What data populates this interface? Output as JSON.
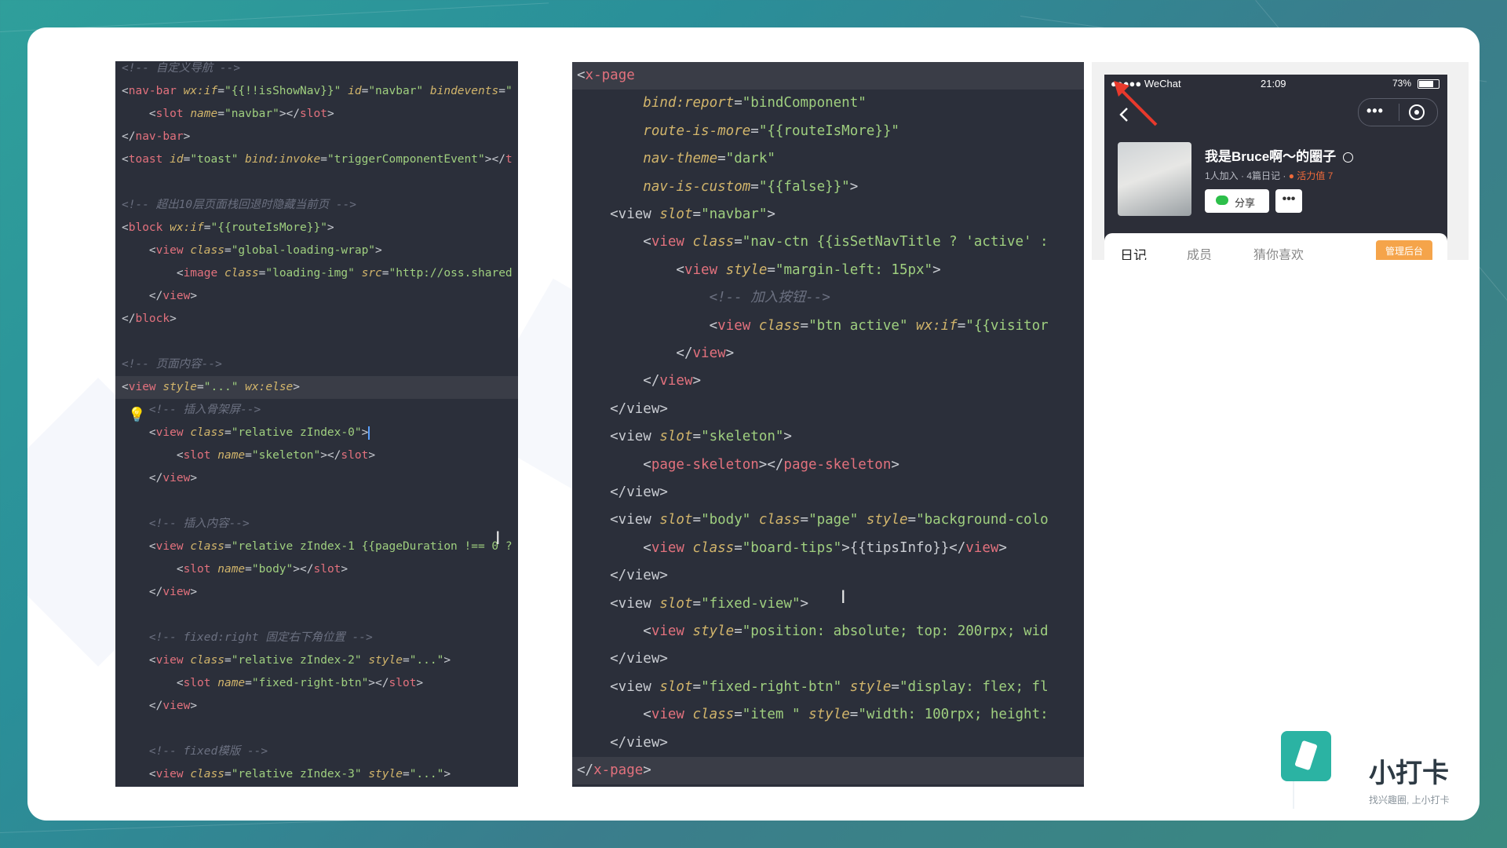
{
  "left_panel": {
    "lines": [
      [
        [
          "c",
          "<!-- 自定义导航 -->"
        ]
      ],
      [
        [
          "p",
          "<"
        ],
        [
          "t",
          "nav-bar"
        ],
        [
          "p",
          " "
        ],
        [
          "a",
          "wx:if"
        ],
        [
          "p",
          "="
        ],
        [
          "v",
          "\"{{!!isShowNav}}\""
        ],
        [
          "p",
          " "
        ],
        [
          "a",
          "id"
        ],
        [
          "p",
          "="
        ],
        [
          "v",
          "\"navbar\""
        ],
        [
          "p",
          " "
        ],
        [
          "a",
          "bindevents"
        ],
        [
          "p",
          "="
        ],
        [
          "v",
          "\""
        ]
      ],
      [
        [
          "p",
          "    <"
        ],
        [
          "t",
          "slot"
        ],
        [
          "p",
          " "
        ],
        [
          "a",
          "name"
        ],
        [
          "p",
          "="
        ],
        [
          "v",
          "\"navbar\""
        ],
        [
          "p",
          "></"
        ],
        [
          "t",
          "slot"
        ],
        [
          "p",
          ">"
        ]
      ],
      [
        [
          "p",
          "</"
        ],
        [
          "t",
          "nav-bar"
        ],
        [
          "p",
          ">"
        ]
      ],
      [
        [
          "p",
          "<"
        ],
        [
          "t",
          "toast"
        ],
        [
          "p",
          " "
        ],
        [
          "a",
          "id"
        ],
        [
          "p",
          "="
        ],
        [
          "v",
          "\"toast\""
        ],
        [
          "p",
          " "
        ],
        [
          "a",
          "bind:invoke"
        ],
        [
          "p",
          "="
        ],
        [
          "v",
          "\"triggerComponentEvent\""
        ],
        [
          "p",
          "></"
        ],
        [
          "t",
          "t"
        ]
      ],
      [
        [
          "p",
          ""
        ]
      ],
      [
        [
          "c",
          "<!-- 超出10层页面栈回退时隐藏当前页 -->"
        ]
      ],
      [
        [
          "p",
          "<"
        ],
        [
          "t",
          "block"
        ],
        [
          "p",
          " "
        ],
        [
          "a",
          "wx:if"
        ],
        [
          "p",
          "="
        ],
        [
          "v",
          "\"{{routeIsMore}}\""
        ],
        [
          "p",
          ">"
        ]
      ],
      [
        [
          "p",
          "    <"
        ],
        [
          "t",
          "view"
        ],
        [
          "p",
          " "
        ],
        [
          "a",
          "class"
        ],
        [
          "p",
          "="
        ],
        [
          "v",
          "\"global-loading-wrap\""
        ],
        [
          "p",
          ">"
        ]
      ],
      [
        [
          "p",
          "        <"
        ],
        [
          "t",
          "image"
        ],
        [
          "p",
          " "
        ],
        [
          "a",
          "class"
        ],
        [
          "p",
          "="
        ],
        [
          "v",
          "\"loading-img\""
        ],
        [
          "p",
          " "
        ],
        [
          "a",
          "src"
        ],
        [
          "p",
          "="
        ],
        [
          "v",
          "\"http://oss.shared"
        ]
      ],
      [
        [
          "p",
          "    </"
        ],
        [
          "t",
          "view"
        ],
        [
          "p",
          ">"
        ]
      ],
      [
        [
          "p",
          "</"
        ],
        [
          "t",
          "block"
        ],
        [
          "p",
          ">"
        ]
      ],
      [
        [
          "p",
          ""
        ]
      ],
      [
        [
          "c",
          "<!-- 页面内容-->"
        ]
      ],
      [
        [
          "p",
          "<"
        ],
        [
          "t",
          "view"
        ],
        [
          "p",
          " "
        ],
        [
          "a",
          "style"
        ],
        [
          "p",
          "="
        ],
        [
          "v",
          "\"...\""
        ],
        [
          "p",
          " "
        ],
        [
          "a",
          "wx:else"
        ],
        [
          "p",
          ">"
        ]
      ],
      [
        [
          "c",
          "    <!-- 插入骨架屏-->"
        ]
      ],
      [
        [
          "p",
          "    <"
        ],
        [
          "t",
          "view"
        ],
        [
          "p",
          " "
        ],
        [
          "a",
          "class"
        ],
        [
          "p",
          "="
        ],
        [
          "v",
          "\"relative zIndex-0\""
        ],
        [
          "p",
          ">"
        ]
      ],
      [
        [
          "p",
          "        <"
        ],
        [
          "t",
          "slot"
        ],
        [
          "p",
          " "
        ],
        [
          "a",
          "name"
        ],
        [
          "p",
          "="
        ],
        [
          "v",
          "\"skeleton\""
        ],
        [
          "p",
          "></"
        ],
        [
          "t",
          "slot"
        ],
        [
          "p",
          ">"
        ]
      ],
      [
        [
          "p",
          "    </"
        ],
        [
          "t",
          "view"
        ],
        [
          "p",
          ">"
        ]
      ],
      [
        [
          "p",
          ""
        ]
      ],
      [
        [
          "c",
          "    <!-- 插入内容-->"
        ]
      ],
      [
        [
          "p",
          "    <"
        ],
        [
          "t",
          "view"
        ],
        [
          "p",
          " "
        ],
        [
          "a",
          "class"
        ],
        [
          "p",
          "="
        ],
        [
          "v",
          "\"relative zIndex-1 {{pageDuration !== 0 ?"
        ]
      ],
      [
        [
          "p",
          "        <"
        ],
        [
          "t",
          "slot"
        ],
        [
          "p",
          " "
        ],
        [
          "a",
          "name"
        ],
        [
          "p",
          "="
        ],
        [
          "v",
          "\"body\""
        ],
        [
          "p",
          "></"
        ],
        [
          "t",
          "slot"
        ],
        [
          "p",
          ">"
        ]
      ],
      [
        [
          "p",
          "    </"
        ],
        [
          "t",
          "view"
        ],
        [
          "p",
          ">"
        ]
      ],
      [
        [
          "p",
          ""
        ]
      ],
      [
        [
          "c",
          "    <!-- fixed:right 固定右下角位置 -->"
        ]
      ],
      [
        [
          "p",
          "    <"
        ],
        [
          "t",
          "view"
        ],
        [
          "p",
          " "
        ],
        [
          "a",
          "class"
        ],
        [
          "p",
          "="
        ],
        [
          "v",
          "\"relative zIndex-2\""
        ],
        [
          "p",
          " "
        ],
        [
          "a",
          "style"
        ],
        [
          "p",
          "="
        ],
        [
          "v",
          "\"...\""
        ],
        [
          "p",
          ">"
        ]
      ],
      [
        [
          "p",
          "        <"
        ],
        [
          "t",
          "slot"
        ],
        [
          "p",
          " "
        ],
        [
          "a",
          "name"
        ],
        [
          "p",
          "="
        ],
        [
          "v",
          "\"fixed-right-btn\""
        ],
        [
          "p",
          "></"
        ],
        [
          "t",
          "slot"
        ],
        [
          "p",
          ">"
        ]
      ],
      [
        [
          "p",
          "    </"
        ],
        [
          "t",
          "view"
        ],
        [
          "p",
          ">"
        ]
      ],
      [
        [
          "p",
          ""
        ]
      ],
      [
        [
          "c",
          "    <!-- fixed模版 -->"
        ]
      ],
      [
        [
          "p",
          "    <"
        ],
        [
          "t",
          "view"
        ],
        [
          "p",
          " "
        ],
        [
          "a",
          "class"
        ],
        [
          "p",
          "="
        ],
        [
          "v",
          "\"relative zIndex-3\""
        ],
        [
          "p",
          " "
        ],
        [
          "a",
          "style"
        ],
        [
          "p",
          "="
        ],
        [
          "v",
          "\"...\""
        ],
        [
          "p",
          ">"
        ]
      ]
    ]
  },
  "middle_panel": {
    "lines": [
      [
        [
          "p",
          "<"
        ],
        [
          "t",
          "x-page"
        ]
      ],
      [
        [
          "p",
          "        "
        ],
        [
          "a",
          "bind:report"
        ],
        [
          "p",
          "="
        ],
        [
          "v",
          "\"bindComponent\""
        ]
      ],
      [
        [
          "p",
          "        "
        ],
        [
          "a",
          "route-is-more"
        ],
        [
          "p",
          "="
        ],
        [
          "v",
          "\"{{routeIsMore}}\""
        ]
      ],
      [
        [
          "p",
          "        "
        ],
        [
          "a",
          "nav-theme"
        ],
        [
          "p",
          "="
        ],
        [
          "v",
          "\"dark\""
        ]
      ],
      [
        [
          "p",
          "        "
        ],
        [
          "a",
          "nav-is-custom"
        ],
        [
          "p",
          "="
        ],
        [
          "v",
          "\"{{false}}\""
        ],
        [
          "p",
          ">"
        ]
      ],
      [
        [
          "p",
          "    <view "
        ],
        [
          "a",
          "slot"
        ],
        [
          "p",
          "="
        ],
        [
          "v",
          "\"navbar\""
        ],
        [
          "p",
          ">"
        ]
      ],
      [
        [
          "p",
          "        <"
        ],
        [
          "t",
          "view"
        ],
        [
          "p",
          " "
        ],
        [
          "a",
          "class"
        ],
        [
          "p",
          "="
        ],
        [
          "v",
          "\"nav-ctn {{isSetNavTitle ? 'active' :"
        ]
      ],
      [
        [
          "p",
          "            <"
        ],
        [
          "t",
          "view"
        ],
        [
          "p",
          " "
        ],
        [
          "a",
          "style"
        ],
        [
          "p",
          "="
        ],
        [
          "v",
          "\"margin-left: 15px\""
        ],
        [
          "p",
          ">"
        ]
      ],
      [
        [
          "c",
          "                <!-- 加入按钮-->"
        ]
      ],
      [
        [
          "p",
          "                <"
        ],
        [
          "t",
          "view"
        ],
        [
          "p",
          " "
        ],
        [
          "a",
          "class"
        ],
        [
          "p",
          "="
        ],
        [
          "v",
          "\"btn active\""
        ],
        [
          "p",
          " "
        ],
        [
          "a",
          "wx:if"
        ],
        [
          "p",
          "="
        ],
        [
          "v",
          "\"{{visitor"
        ]
      ],
      [
        [
          "p",
          "            </"
        ],
        [
          "t",
          "view"
        ],
        [
          "p",
          ">"
        ]
      ],
      [
        [
          "p",
          "        </"
        ],
        [
          "t",
          "view"
        ],
        [
          "p",
          ">"
        ]
      ],
      [
        [
          "p",
          "    </view>"
        ]
      ],
      [
        [
          "p",
          "    <view "
        ],
        [
          "a",
          "slot"
        ],
        [
          "p",
          "="
        ],
        [
          "v",
          "\"skeleton\""
        ],
        [
          "p",
          ">"
        ]
      ],
      [
        [
          "p",
          "        <"
        ],
        [
          "t",
          "page-skeleton"
        ],
        [
          "p",
          "></"
        ],
        [
          "t",
          "page-skeleton"
        ],
        [
          "p",
          ">"
        ]
      ],
      [
        [
          "p",
          "    </view>"
        ]
      ],
      [
        [
          "p",
          "    <view "
        ],
        [
          "a",
          "slot"
        ],
        [
          "p",
          "="
        ],
        [
          "v",
          "\"body\""
        ],
        [
          "p",
          " "
        ],
        [
          "a",
          "class"
        ],
        [
          "p",
          "="
        ],
        [
          "v",
          "\"page\""
        ],
        [
          "p",
          " "
        ],
        [
          "a",
          "style"
        ],
        [
          "p",
          "="
        ],
        [
          "v",
          "\"background-colo"
        ]
      ],
      [
        [
          "p",
          "        <"
        ],
        [
          "t",
          "view"
        ],
        [
          "p",
          " "
        ],
        [
          "a",
          "class"
        ],
        [
          "p",
          "="
        ],
        [
          "v",
          "\"board-tips\""
        ],
        [
          "p",
          ">{{tipsInfo}}</"
        ],
        [
          "t",
          "view"
        ],
        [
          "p",
          ">"
        ]
      ],
      [
        [
          "p",
          "    </view>"
        ]
      ],
      [
        [
          "p",
          "    <view "
        ],
        [
          "a",
          "slot"
        ],
        [
          "p",
          "="
        ],
        [
          "v",
          "\"fixed-view\""
        ],
        [
          "p",
          ">"
        ]
      ],
      [
        [
          "p",
          "        <"
        ],
        [
          "t",
          "view"
        ],
        [
          "p",
          " "
        ],
        [
          "a",
          "style"
        ],
        [
          "p",
          "="
        ],
        [
          "v",
          "\"position: absolute; top: 200rpx; wid"
        ]
      ],
      [
        [
          "p",
          "    </view>"
        ]
      ],
      [
        [
          "p",
          "    <view "
        ],
        [
          "a",
          "slot"
        ],
        [
          "p",
          "="
        ],
        [
          "v",
          "\"fixed-right-btn\""
        ],
        [
          "p",
          " "
        ],
        [
          "a",
          "style"
        ],
        [
          "p",
          "="
        ],
        [
          "v",
          "\"display: flex; fl"
        ]
      ],
      [
        [
          "p",
          "        <"
        ],
        [
          "t",
          "view"
        ],
        [
          "p",
          " "
        ],
        [
          "a",
          "class"
        ],
        [
          "p",
          "="
        ],
        [
          "v",
          "\"item \""
        ],
        [
          "p",
          " "
        ],
        [
          "a",
          "style"
        ],
        [
          "p",
          "="
        ],
        [
          "v",
          "\"width: 100rpx; height:"
        ]
      ],
      [
        [
          "p",
          "    </view>"
        ]
      ],
      [
        [
          "p",
          "</"
        ],
        [
          "t",
          "x-page"
        ],
        [
          "p",
          ">"
        ]
      ]
    ]
  },
  "phone": {
    "carrier": "●●●●● WeChat",
    "time": "21:09",
    "battery": "73%",
    "title": "我是Bruce啊～的圈子",
    "meta": "1人加入 · 4篇日记 ·",
    "vitality": "活力值 7",
    "share_label": "分享",
    "tabs": [
      "日记",
      "成员",
      "猜你喜欢"
    ],
    "admin_label": "管理后台"
  },
  "brand": {
    "name": "小打卡",
    "slogan": "找兴趣圈, 上小打卡"
  },
  "colors": {
    "accent": "#2bb3a3",
    "admin": "#f5a44a",
    "vitality": "#f06a3a",
    "arrow": "#e8392c"
  }
}
